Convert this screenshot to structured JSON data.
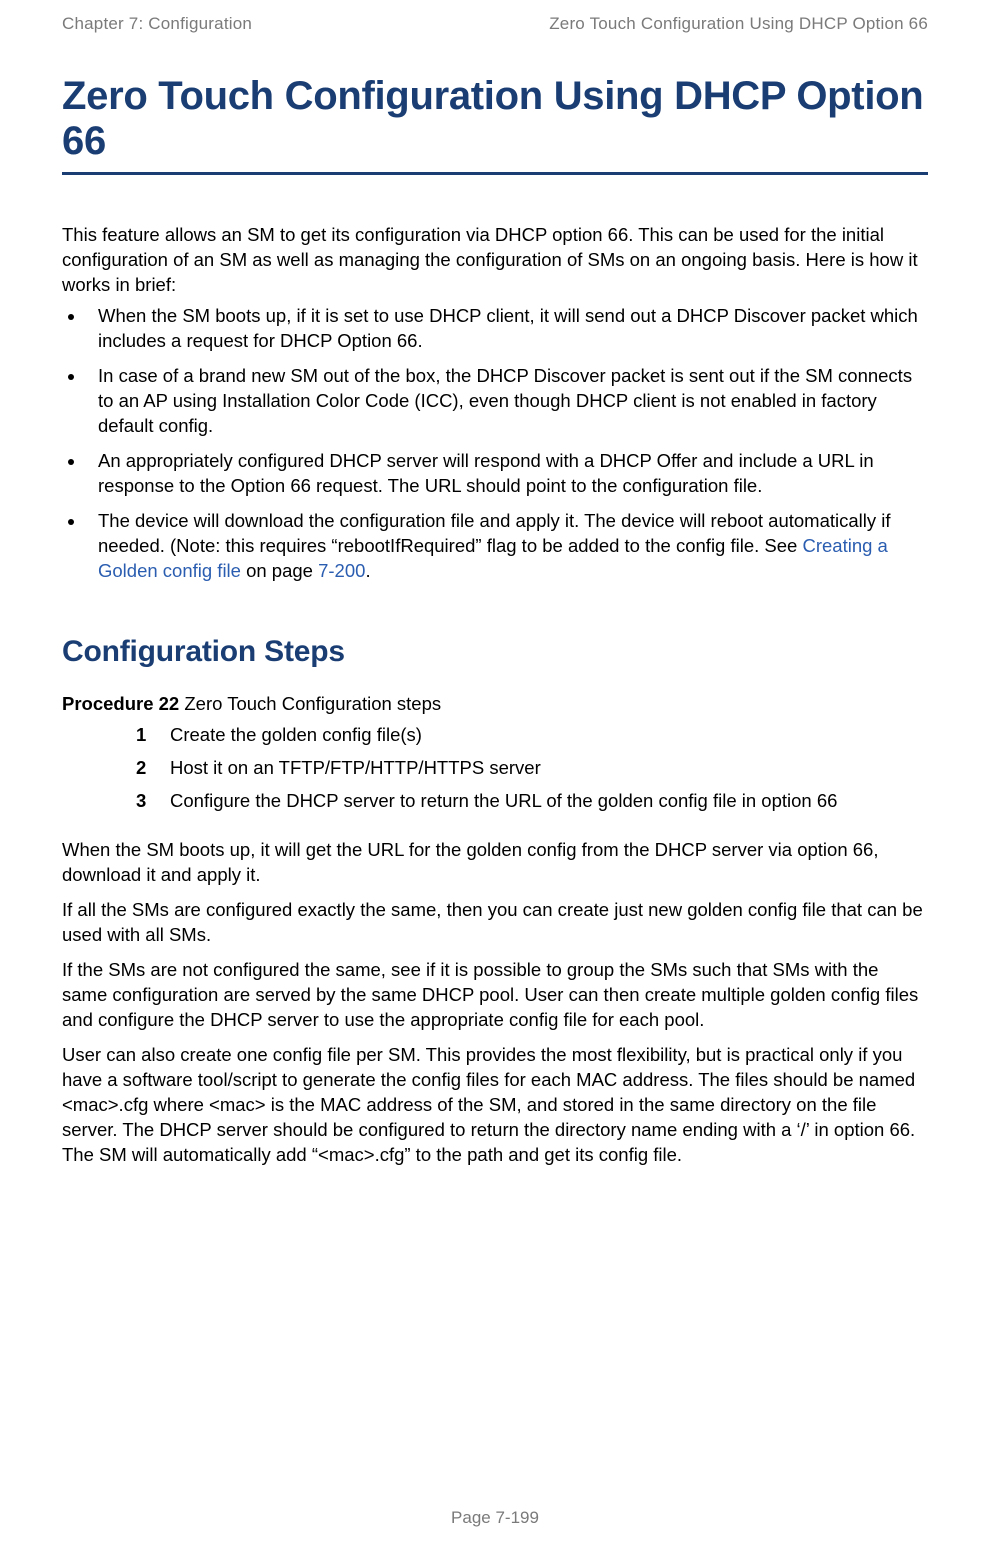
{
  "header": {
    "left": "Chapter 7:  Configuration",
    "right": "Zero Touch Configuration Using DHCP Option 66"
  },
  "title": "Zero Touch Configuration Using DHCP Option 66",
  "intro": "This feature allows an SM to get its configuration via DHCP option 66. This can be used for the initial configuration of an SM as well as managing the configuration of SMs on an ongoing basis. Here is how it works in brief:",
  "bullets": [
    "When the SM boots up, if it is set to use DHCP client, it will send out a DHCP Discover packet which includes a request for DHCP Option 66.",
    "In case of a brand new SM out of the box, the DHCP Discover packet is sent out if the SM connects to an AP using Installation Color Code (ICC), even though DHCP client is not enabled in factory default config.",
    "An appropriately configured DHCP server will respond with a DHCP Offer and include a URL in response to the Option 66 request. The URL should point to the configuration file."
  ],
  "bullet4_pre": "The device will download the configuration file and apply it. The device will reboot automatically if needed. (Note: this requires “rebootIfRequired” flag to be added to the config file. See ",
  "bullet4_link": "Creating a Golden config file",
  "bullet4_mid": " on page ",
  "bullet4_pageref": "7-200",
  "bullet4_post": ".",
  "section_title": "Configuration Steps",
  "procedure_label": "Procedure 22",
  "procedure_title": " Zero Touch Configuration steps",
  "steps": [
    "Create the golden config file(s)",
    "Host it on an TFTP/FTP/HTTP/HTTPS server",
    "Configure the DHCP server to return the URL of the golden config file in option 66"
  ],
  "paras": [
    "When the SM boots up, it will get the URL for the golden config from the DHCP server via option 66, download it and apply it.",
    "If all the SMs are configured exactly the same, then you can create just new golden config file that can be used with all SMs.",
    "If the SMs are not configured the same, see if it is possible to group the SMs such that SMs with the same configuration are served by the same DHCP pool. User can then create multiple golden config files and configure the DHCP server to use the appropriate config file for each pool.",
    "User can also create one config file per SM. This provides the most flexibility, but is practical only if you have a software tool/script to generate the config files for each MAC address. The files should be named <mac>.cfg where <mac> is the MAC address of the SM, and stored in the same directory on the file server. The DHCP server should be configured to return the directory name ending with a ‘/’ in option 66. The SM will automatically add “<mac>.cfg” to the path and get its config file."
  ],
  "footer": "Page 7-199"
}
